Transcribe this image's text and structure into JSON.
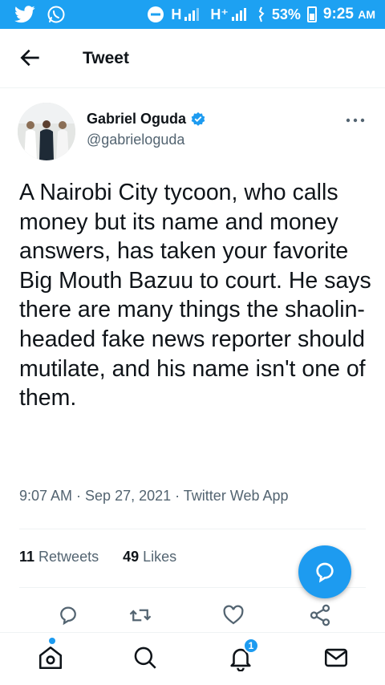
{
  "status_bar": {
    "net_label_1": "H",
    "net_label_2": "H⁺",
    "battery": "53%",
    "time": "9:25",
    "ampm": "AM"
  },
  "header": {
    "title": "Tweet"
  },
  "tweet": {
    "author_name": "Gabriel Oguda",
    "author_handle": "@gabrieloguda",
    "text": "A Nairobi City tycoon, who calls money but its name and money answers, has taken your favorite Big Mouth Bazuu to court. He says there are many things the shaolin-headed fake news reporter should mutilate, and his name isn't one of them.",
    "meta": "9:07 AM · Sep 27, 2021 · Twitter Web App",
    "retweets_count": "11",
    "retweets_label": "Retweets",
    "likes_count": "49",
    "likes_label": "Likes"
  },
  "icons": [
    "back-arrow-icon",
    "verified-icon",
    "more-icon",
    "reply-icon",
    "retweet-icon",
    "like-icon",
    "share-icon",
    "compose-icon",
    "home-icon",
    "search-icon",
    "notifications-icon",
    "messages-icon"
  ],
  "nav": {
    "notifications_badge": "1"
  },
  "colors": {
    "status_bar": "#1da1f2",
    "accent": "#1d9bf0",
    "text": "#0f1419",
    "secondary": "#536471"
  }
}
